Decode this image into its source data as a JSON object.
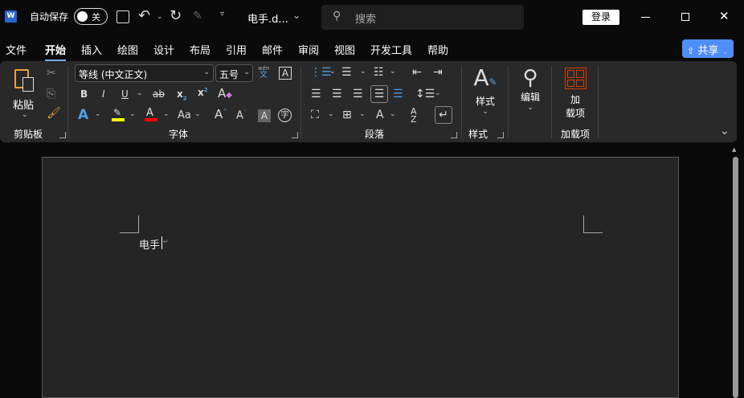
{
  "titlebar": {
    "autosave_label": "自动保存",
    "autosave_state": "关",
    "doc_title": "电手.d...",
    "search_placeholder": "搜索",
    "login_label": "登录"
  },
  "tabs": [
    "文件",
    "开始",
    "插入",
    "绘图",
    "设计",
    "布局",
    "引用",
    "邮件",
    "审阅",
    "视图",
    "开发工具",
    "帮助"
  ],
  "share_label": "共享",
  "ribbon": {
    "clipboard": {
      "paste_label": "粘贴",
      "group_label": "剪贴板"
    },
    "font": {
      "font_name": "等线 (中文正文)",
      "font_size": "五号",
      "group_label": "字体",
      "phonetic_top": "wén",
      "phonetic_bottom": "文",
      "case_label": "Aa"
    },
    "paragraph": {
      "group_label": "段落"
    },
    "styles": {
      "label": "样式",
      "group_label": "样式"
    },
    "editing": {
      "label": "编辑"
    },
    "addins": {
      "label_line1": "加",
      "label_line2": "载项",
      "group_label": "加载项"
    }
  },
  "document": {
    "text": "电手"
  },
  "colors": {
    "highlight": "#ffff00",
    "font_color": "#ff0000",
    "accent": "#4f8ef7",
    "addin_red": "#d83b01"
  }
}
